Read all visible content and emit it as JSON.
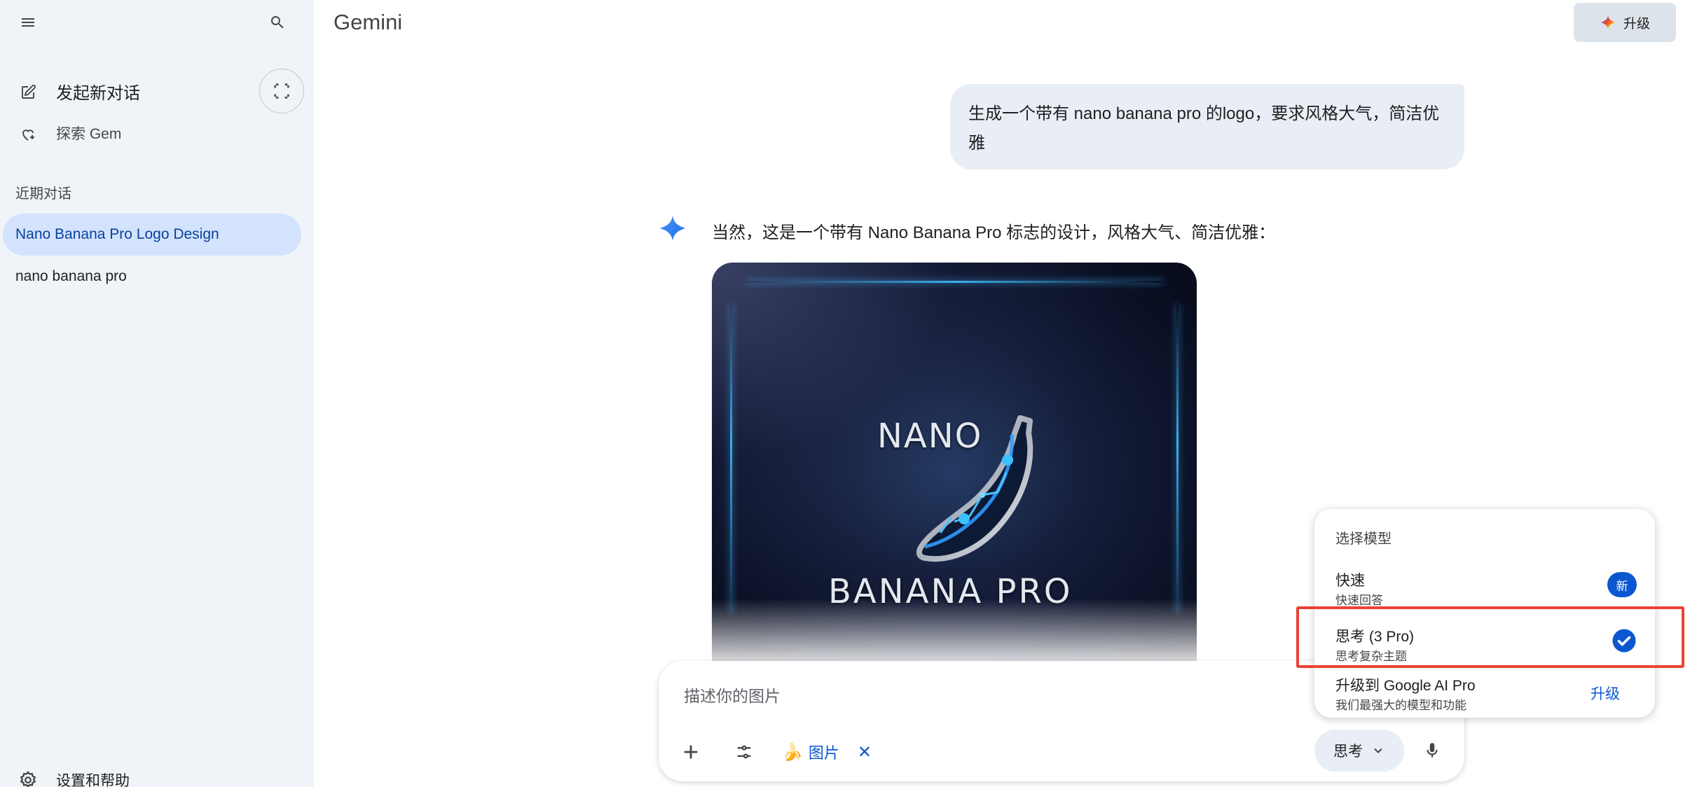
{
  "app": {
    "title": "Gemini",
    "upgrade_label": "升级"
  },
  "sidebar": {
    "new_chat": "发起新对话",
    "explore_gem": "探索 Gem",
    "recent_title": "近期对话",
    "conversations": [
      {
        "label": "Nano Banana Pro Logo Design",
        "active": true
      },
      {
        "label": "nano banana pro",
        "active": false
      }
    ],
    "settings": "设置和帮助"
  },
  "chat": {
    "user_message": "生成一个带有 nano banana pro 的logo，要求风格大气，简洁优雅",
    "response_text": "当然，这是一个带有 Nano Banana Pro 标志的设计，风格大气、简洁优雅：",
    "image": {
      "logo_top": "NANO",
      "logo_bottom": "BANANA PRO"
    }
  },
  "input": {
    "placeholder": "描述你的图片",
    "chip_emoji": "🍌",
    "chip_label": "图片",
    "chip_close": "✕",
    "mode_label": "思考"
  },
  "model_menu": {
    "title": "选择模型",
    "items": [
      {
        "title": "快速",
        "subtitle": "快速回答",
        "badge": "新"
      },
      {
        "title": "思考 (3 Pro)",
        "subtitle": "思考复杂主题",
        "selected": true
      },
      {
        "title": "升级到 Google AI Pro",
        "subtitle": "我们最强大的模型和功能",
        "action": "升级"
      }
    ]
  },
  "colors": {
    "accent": "#0b57d0",
    "sidebar_bg": "#f0f4f9",
    "active_conv": "#d3e3fd",
    "highlight": "#ea4335"
  }
}
